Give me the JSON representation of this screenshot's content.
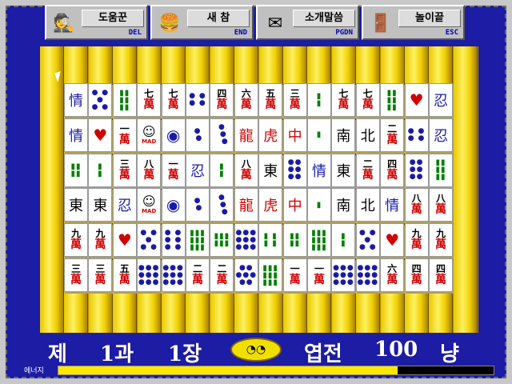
{
  "toolbar": [
    {
      "name": "help",
      "label": "도움꾼",
      "key": "DEL",
      "icon": "detective-icon",
      "glyph": "🕵"
    },
    {
      "name": "new",
      "label": "새 참",
      "key": "END",
      "icon": "hamburger-icon",
      "glyph": "🍔"
    },
    {
      "name": "intro",
      "label": "소개말씀",
      "key": "PGDN",
      "icon": "envelope-icon",
      "glyph": "✉"
    },
    {
      "name": "exit",
      "label": "놀이끝",
      "key": "ESC",
      "icon": "exit-door-icon",
      "glyph": "🚪"
    }
  ],
  "board": {
    "columns": 18,
    "rows": [
      [
        {
          "t": "hanzi",
          "v": "情",
          "c": "blue"
        },
        {
          "t": "dots",
          "v": "● ●\n ● \n● ●"
        },
        {
          "t": "bars",
          "v": "▮▮\n▮▮\n▮▮"
        },
        {
          "t": "wan",
          "n": "七"
        },
        {
          "t": "wan",
          "n": "七"
        },
        {
          "t": "dots",
          "v": "● ●\n● ●"
        },
        {
          "t": "wan",
          "n": "四"
        },
        {
          "t": "wan",
          "n": "六"
        },
        {
          "t": "wan",
          "n": "五"
        },
        {
          "t": "wan",
          "n": "三"
        },
        {
          "t": "bars",
          "v": "▮\n▮"
        },
        {
          "t": "wan",
          "n": "七"
        },
        {
          "t": "wan",
          "n": "七"
        },
        {
          "t": "bars",
          "v": "▮▮\n▮▮\n▮▮"
        },
        {
          "t": "heart",
          "v": "♥"
        },
        {
          "t": "hanzi",
          "v": "忍",
          "c": "blue"
        }
      ],
      [
        {
          "t": "hanzi",
          "v": "情",
          "c": "blue"
        },
        {
          "t": "heart",
          "v": "♥"
        },
        {
          "t": "wan",
          "n": "一"
        },
        {
          "t": "mad",
          "v": "MAD"
        },
        {
          "t": "circ",
          "v": "◉"
        },
        {
          "t": "dots",
          "v": "●\n ●"
        },
        {
          "t": "dots",
          "v": "●\n ●\n  ●"
        },
        {
          "t": "hanzi",
          "v": "龍",
          "c": "red"
        },
        {
          "t": "hanzi",
          "v": "虎",
          "c": "red"
        },
        {
          "t": "hanzi",
          "v": "中",
          "c": "red"
        },
        {
          "t": "bars",
          "v": "▮"
        },
        {
          "t": "hanzi",
          "v": "南",
          "c": ""
        },
        {
          "t": "hanzi",
          "v": "北",
          "c": ""
        },
        {
          "t": "wan",
          "n": "二"
        },
        {
          "t": "dots",
          "v": "● ●\n● ●"
        },
        {
          "t": "hanzi",
          "v": "忍",
          "c": "blue"
        }
      ],
      [
        {
          "t": "bars",
          "v": "▮▮\n▮▮"
        },
        {
          "t": "bars",
          "v": "▮\n▮"
        },
        {
          "t": "wan",
          "n": "三"
        },
        {
          "t": "wan",
          "n": "八"
        },
        {
          "t": "wan",
          "n": "一"
        },
        {
          "t": "hanzi",
          "v": "忍",
          "c": "blue"
        },
        {
          "t": "bars",
          "v": "▮\n▮"
        },
        {
          "t": "wan",
          "n": "八"
        },
        {
          "t": "hanzi",
          "v": "東",
          "c": ""
        },
        {
          "t": "dots",
          "v": "●●\n●●\n●●"
        },
        {
          "t": "hanzi",
          "v": "情",
          "c": "blue"
        },
        {
          "t": "hanzi",
          "v": "東",
          "c": ""
        },
        {
          "t": "wan",
          "n": "二"
        },
        {
          "t": "wan",
          "n": "四"
        },
        {
          "t": "dots",
          "v": "●●\n●●\n●●"
        },
        {
          "t": "bars",
          "v": "▮▮\n▮▮\n▮▮"
        }
      ],
      [
        {
          "t": "hanzi",
          "v": "東",
          "c": ""
        },
        {
          "t": "hanzi",
          "v": "東",
          "c": ""
        },
        {
          "t": "hanzi",
          "v": "忍",
          "c": "blue"
        },
        {
          "t": "mad",
          "v": "MAD"
        },
        {
          "t": "circ",
          "v": "◉"
        },
        {
          "t": "dots",
          "v": "●\n ●"
        },
        {
          "t": "dots",
          "v": "●\n ●\n  ●"
        },
        {
          "t": "hanzi",
          "v": "龍",
          "c": "red"
        },
        {
          "t": "hanzi",
          "v": "虎",
          "c": "red"
        },
        {
          "t": "hanzi",
          "v": "中",
          "c": "red"
        },
        {
          "t": "bars",
          "v": "▮"
        },
        {
          "t": "hanzi",
          "v": "南",
          "c": ""
        },
        {
          "t": "hanzi",
          "v": "北",
          "c": ""
        },
        {
          "t": "hanzi",
          "v": "情",
          "c": "blue"
        },
        {
          "t": "wan",
          "n": "八"
        },
        {
          "t": "wan",
          "n": "八"
        }
      ],
      [
        {
          "t": "wan",
          "n": "九"
        },
        {
          "t": "wan",
          "n": "九"
        },
        {
          "t": "heart",
          "v": "♥"
        },
        {
          "t": "dots",
          "v": "● ●\n ● \n● ●"
        },
        {
          "t": "dots",
          "v": "● ●\n● ●\n● ●"
        },
        {
          "t": "bars",
          "v": "▮▮▮\n▮▮▮\n▮▮▮"
        },
        {
          "t": "bars",
          "v": "▮▮▮\n▮▮▮"
        },
        {
          "t": "dots",
          "v": "●●●\n●●●\n●●●"
        },
        {
          "t": "bars",
          "v": "▮ ▮\n▮ ▮"
        },
        {
          "t": "bars",
          "v": "▮▮\n▮▮"
        },
        {
          "t": "bars",
          "v": "▮▮▮\n▮▮▮\n▮▮▮"
        },
        {
          "t": "bars",
          "v": "▮\n▮"
        },
        {
          "t": "dots",
          "v": "● ●\n ● \n● ●"
        },
        {
          "t": "heart",
          "v": "♥"
        },
        {
          "t": "wan",
          "n": "九"
        },
        {
          "t": "wan",
          "n": "九"
        }
      ],
      [
        {
          "t": "wan",
          "n": "三"
        },
        {
          "t": "wan",
          "n": "三"
        },
        {
          "t": "wan",
          "n": "五"
        },
        {
          "t": "dots",
          "v": "●●●\n●●●\n●●●"
        },
        {
          "t": "dots",
          "v": "●●●\n●●●\n●●●"
        },
        {
          "t": "wan",
          "n": "二"
        },
        {
          "t": "wan",
          "n": "二"
        },
        {
          "t": "dots",
          "v": "●●\n●●●\n●●"
        },
        {
          "t": "bars",
          "v": "▮▮▮\n▮▮▮\n▮▮▮"
        },
        {
          "t": "wan",
          "n": "一"
        },
        {
          "t": "wan",
          "n": "一"
        },
        {
          "t": "dots",
          "v": "●●●\n●●●\n●●●"
        },
        {
          "t": "dots",
          "v": "●●●\n●●●\n●●●"
        },
        {
          "t": "wan",
          "n": "六"
        },
        {
          "t": "wan",
          "n": "四"
        },
        {
          "t": "wan",
          "n": "四"
        }
      ]
    ]
  },
  "status": {
    "chapter_prefix": "제",
    "chapter": "1과",
    "stage": "1장",
    "money_label": "엽전",
    "money": "100",
    "money_unit": "냥"
  },
  "energy": {
    "label": "에너지",
    "fraction": 0.78
  },
  "colors": {
    "background": "#1c1ca4",
    "wan_red": "#d00000",
    "tile_gold": "#f0d000"
  }
}
